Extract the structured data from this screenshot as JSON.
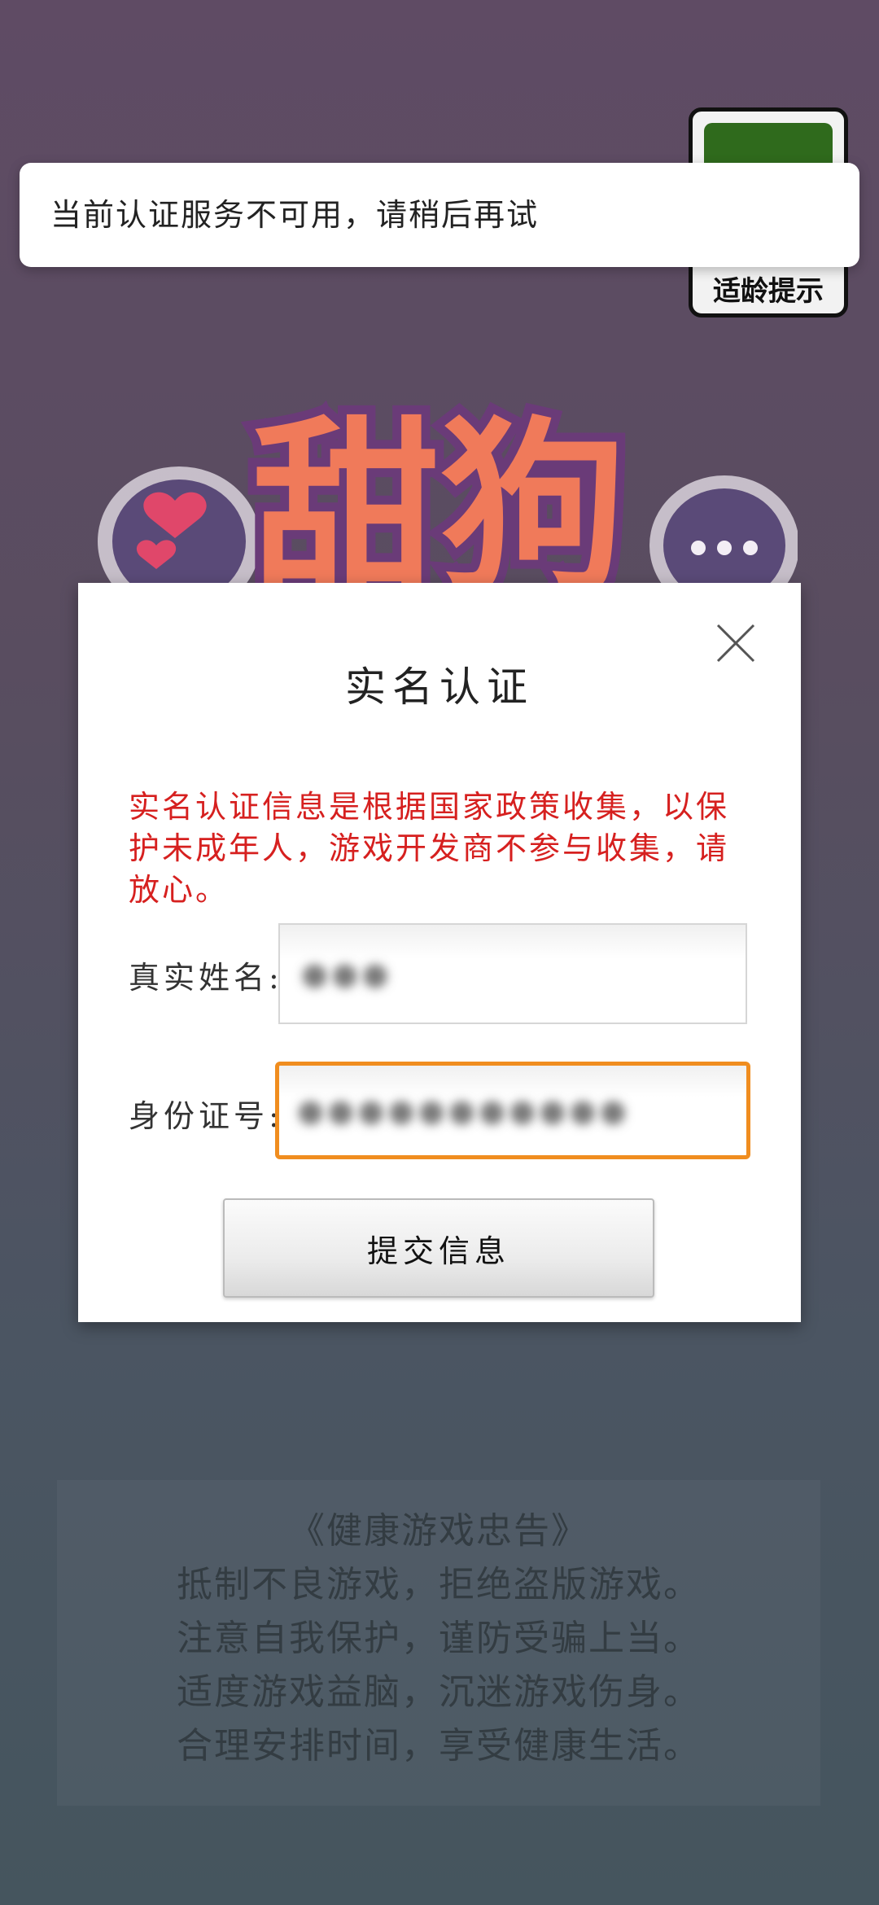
{
  "age_badge": {
    "label": "适龄提示"
  },
  "toast": {
    "message": "当前认证服务不可用，请稍后再试"
  },
  "logo": {
    "text": "甜狗"
  },
  "dialog": {
    "title": "实名认证",
    "notice": "实名认证信息是根据国家政策收集，以保护未成年人，游戏开发商不参与收集，请放心。",
    "name_label": "真实姓名:",
    "name_value": "●●●",
    "id_label": "身份证号:",
    "id_value": "●●●●●●●●●●●",
    "submit_label": "提交信息"
  },
  "health": {
    "title": "《健康游戏忠告》",
    "lines": [
      "抵制不良游戏，拒绝盗版游戏。",
      "注意自我保护，谨防受骗上当。",
      "适度游戏益脑，沉迷游戏伤身。",
      "合理安排时间，享受健康生活。"
    ]
  },
  "colors": {
    "notice_red": "#d6201f",
    "input_focus_orange": "#f08d1f",
    "badge_green": "#2f6a1c"
  }
}
